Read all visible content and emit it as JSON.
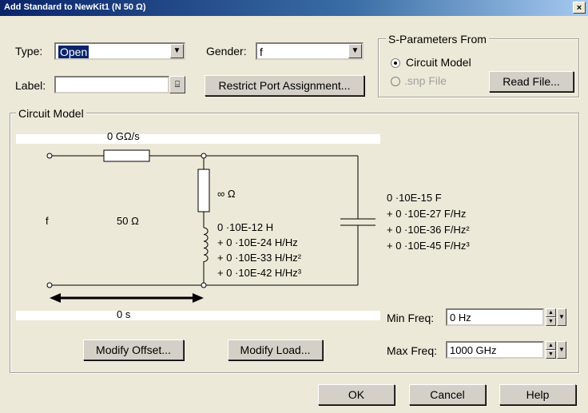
{
  "window": {
    "title": "Add Standard to NewKit1 (N 50 Ω)",
    "close_glyph": "×"
  },
  "type_field": {
    "label": "Type:",
    "value": "Open"
  },
  "gender_field": {
    "label": "Gender:",
    "value": "f"
  },
  "label_field": {
    "label": "Label:",
    "value": ""
  },
  "restrict_button": "Restrict Port Assignment...",
  "sparams": {
    "title": "S-Parameters From",
    "options": [
      {
        "label": "Circuit Model",
        "selected": true,
        "enabled": true
      },
      {
        "label": ".snp File",
        "selected": false,
        "enabled": false
      }
    ],
    "read_file_button": "Read File..."
  },
  "circuit": {
    "title": "Circuit Model",
    "offset_loss": "0 GΩ/s",
    "port_label": "f",
    "impedance": "50 Ω",
    "resistor": "∞ Ω",
    "inductance": [
      "0 ·10E-12 H",
      "+ 0 ·10E-24 H/Hz",
      "+ 0 ·10E-33 H/Hz²",
      "+ 0 ·10E-42 H/Hz³"
    ],
    "capacitance": [
      "0 ·10E-15 F",
      "+ 0 ·10E-27 F/Hz",
      "+ 0 ·10E-36 F/Hz²",
      "+ 0 ·10E-45 F/Hz³"
    ],
    "delay": "0 s",
    "min_freq_label": "Min Freq:",
    "min_freq_value": "0 Hz",
    "max_freq_label": "Max Freq:",
    "max_freq_value": "1000 GHz",
    "modify_offset_button": "Modify Offset...",
    "modify_load_button": "Modify Load..."
  },
  "footer": {
    "ok": "OK",
    "cancel": "Cancel",
    "help": "Help"
  },
  "icons": {
    "dropdown": "chevron-down-icon",
    "browse": "browse-icon",
    "spin": "spinner-icon"
  }
}
